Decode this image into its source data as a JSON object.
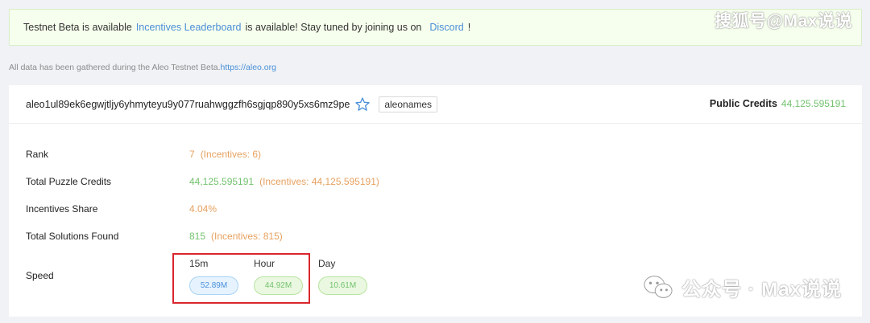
{
  "banner": {
    "text1": "Testnet Beta is available",
    "link1": "Incentives Leaderboard",
    "text2": "is available! Stay tuned by joining us on",
    "link2": "Discord",
    "text3": "!"
  },
  "note": {
    "text": "All data has been gathered during the Aleo Testnet Beta.",
    "link": "https://aleo.org"
  },
  "header": {
    "address": "aleo1ul89ek6egwjtljy6yhmyteyu9y077ruahwggzfh6sgjqp890y5xs6mz9pe",
    "tag": "aleonames",
    "public_credits_label": "Public Credits",
    "public_credits_value": "44,125.595191"
  },
  "rows": {
    "rank": {
      "label": "Rank",
      "value": "7",
      "extra": "(Incentives: 6)"
    },
    "puzzle": {
      "label": "Total Puzzle Credits",
      "value": "44,125.595191",
      "extra": "(Incentives: 44,125.595191)"
    },
    "share": {
      "label": "Incentives Share",
      "value": "4.04%"
    },
    "solutions": {
      "label": "Total Solutions Found",
      "value": "815",
      "extra": "(Incentives: 815)"
    }
  },
  "speed": {
    "label": "Speed",
    "cols": [
      {
        "head": "15m",
        "value": "52.89M"
      },
      {
        "head": "Hour",
        "value": "44.92M"
      },
      {
        "head": "Day",
        "value": "10.61M"
      }
    ]
  },
  "watermark": {
    "top": "搜狐号@Max说说",
    "bottom": "公众号 · Max说说"
  },
  "colors": {
    "link": "#4a8fd9",
    "orange": "#e7a160",
    "green": "#73c26e",
    "highlight": "#d9262c"
  }
}
